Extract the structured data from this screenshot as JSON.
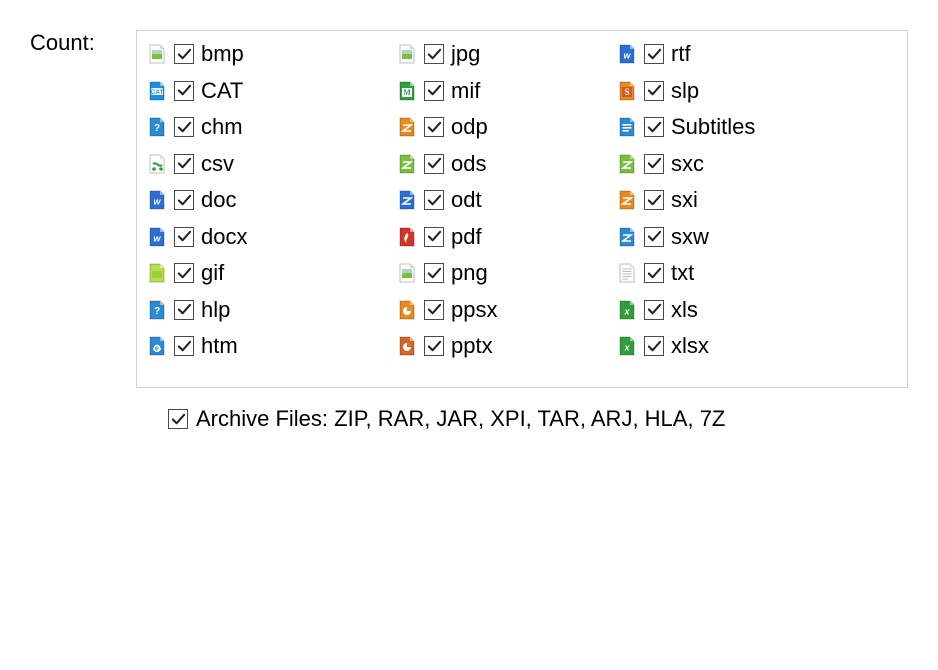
{
  "label": "Count:",
  "cols": [
    [
      {
        "name": "bmp",
        "icon": "image-green",
        "checked": true
      },
      {
        "name": "CAT",
        "icon": "cat",
        "checked": true
      },
      {
        "name": "chm",
        "icon": "help-blue",
        "checked": true
      },
      {
        "name": "csv",
        "icon": "csv",
        "checked": true
      },
      {
        "name": "doc",
        "icon": "word",
        "checked": true
      },
      {
        "name": "docx",
        "icon": "word",
        "checked": true
      },
      {
        "name": "gif",
        "icon": "image-lime",
        "checked": true
      },
      {
        "name": "hlp",
        "icon": "help-blue",
        "checked": true
      },
      {
        "name": "htm",
        "icon": "ie",
        "checked": true
      }
    ],
    [
      {
        "name": "jpg",
        "icon": "image-green",
        "checked": true
      },
      {
        "name": "mif",
        "icon": "mif",
        "checked": true
      },
      {
        "name": "odp",
        "icon": "odp",
        "checked": true
      },
      {
        "name": "ods",
        "icon": "ods",
        "checked": true
      },
      {
        "name": "odt",
        "icon": "odt",
        "checked": true
      },
      {
        "name": "pdf",
        "icon": "pdf",
        "checked": true
      },
      {
        "name": "png",
        "icon": "image-green",
        "checked": true
      },
      {
        "name": "ppsx",
        "icon": "ppsx",
        "checked": true
      },
      {
        "name": "pptx",
        "icon": "pptx",
        "checked": true
      }
    ],
    [
      {
        "name": "rtf",
        "icon": "word",
        "checked": true
      },
      {
        "name": "slp",
        "icon": "slp",
        "checked": true
      },
      {
        "name": "Subtitles",
        "icon": "subtitles",
        "checked": true
      },
      {
        "name": "sxc",
        "icon": "sxc",
        "checked": true
      },
      {
        "name": "sxi",
        "icon": "sxi",
        "checked": true
      },
      {
        "name": "sxw",
        "icon": "sxw",
        "checked": true
      },
      {
        "name": "txt",
        "icon": "txt",
        "checked": true
      },
      {
        "name": "xls",
        "icon": "xls",
        "checked": true
      },
      {
        "name": "xlsx",
        "icon": "xls",
        "checked": true
      }
    ]
  ],
  "archive": {
    "checked": true,
    "label": "Archive Files: ZIP, RAR, JAR, XPI, TAR, ARJ, HLA, 7Z"
  }
}
